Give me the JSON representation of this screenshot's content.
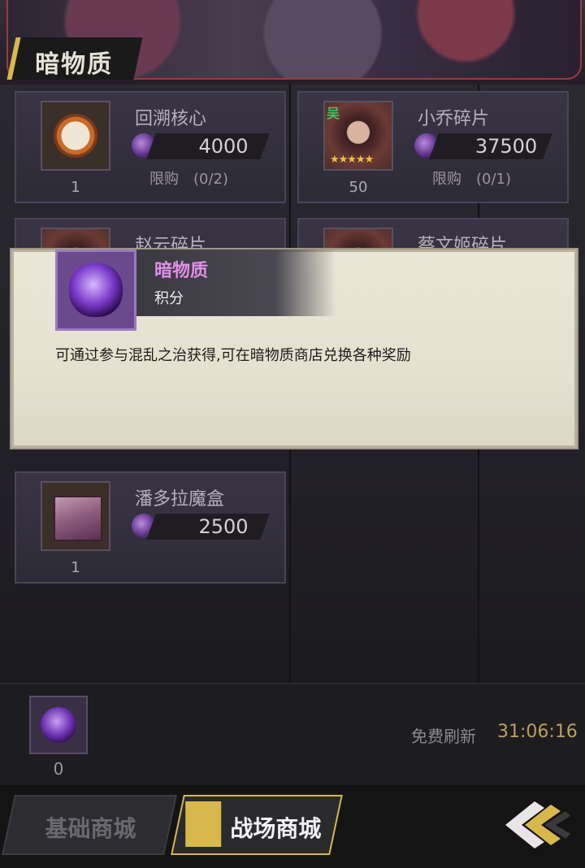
{
  "banner": {
    "title": "暗物质"
  },
  "items": [
    {
      "name": "回溯核心",
      "price": "4000",
      "limit": "限购　(0/2)",
      "qty": "1",
      "icon": "compass-icon"
    },
    {
      "name": "小乔碎片",
      "price": "37500",
      "limit": "限购　(0/1)",
      "qty": "50",
      "icon": "hero-portrait-icon",
      "tag": "吴"
    },
    {
      "name": "赵云碎片",
      "icon": "hero-portrait-icon"
    },
    {
      "name": "蔡文姬碎片",
      "icon": "hero-portrait-icon"
    },
    {
      "name": "潘多拉魔盒",
      "price": "2500",
      "qty": "1",
      "icon": "box-icon"
    }
  ],
  "tooltip": {
    "name": "暗物质",
    "type": "积分",
    "description": "可通过参与混乱之治获得,可在暗物质商店兑换各种奖励"
  },
  "currency": {
    "count": "0",
    "icon": "dark-matter-icon"
  },
  "refresh": {
    "label": "免费刷新",
    "time": "31:06:16"
  },
  "tabs": {
    "basic": "基础商城",
    "battle": "战场商城"
  },
  "colors": {
    "accent_gold": "#d8b84a",
    "tooltip_name": "#e090e8",
    "timer": "#b8a060"
  }
}
